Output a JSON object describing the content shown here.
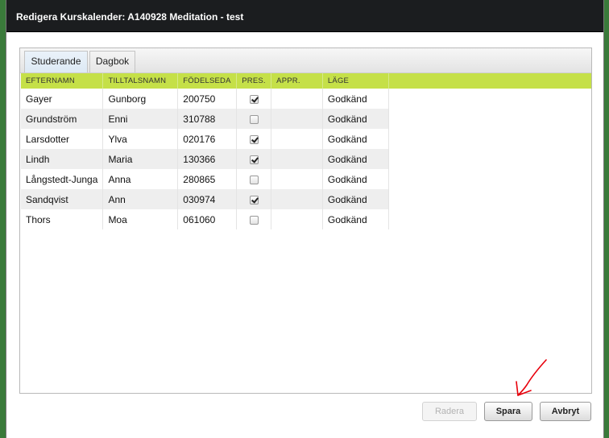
{
  "dialog": {
    "title": "Redigera Kurskalender: A140928 Meditation - test"
  },
  "tabs": [
    {
      "label": "Studerande",
      "active": true
    },
    {
      "label": "Dagbok",
      "active": false
    }
  ],
  "table": {
    "headers": [
      "EFTERNAMN",
      "TILLTALSNAMN",
      "FÖDELSEDA",
      "PRES.",
      "APPR.",
      "LÄGE"
    ],
    "rows": [
      {
        "efternamn": "Gayer",
        "tilltalsnamn": "Gunborg",
        "fodelse": "200750",
        "pres": true,
        "appr": "",
        "lage": "Godkänd"
      },
      {
        "efternamn": "Grundström",
        "tilltalsnamn": "Enni",
        "fodelse": "310788",
        "pres": false,
        "appr": "",
        "lage": "Godkänd"
      },
      {
        "efternamn": "Larsdotter",
        "tilltalsnamn": "Ylva",
        "fodelse": "020176",
        "pres": true,
        "appr": "",
        "lage": "Godkänd"
      },
      {
        "efternamn": "Lindh",
        "tilltalsnamn": "Maria",
        "fodelse": "130366",
        "pres": true,
        "appr": "",
        "lage": "Godkänd"
      },
      {
        "efternamn": "Långstedt-Junga",
        "tilltalsnamn": "Anna",
        "fodelse": "280865",
        "pres": false,
        "appr": "",
        "lage": "Godkänd"
      },
      {
        "efternamn": "Sandqvist",
        "tilltalsnamn": "Ann",
        "fodelse": "030974",
        "pres": true,
        "appr": "",
        "lage": "Godkänd"
      },
      {
        "efternamn": "Thors",
        "tilltalsnamn": "Moa",
        "fodelse": "061060",
        "pres": false,
        "appr": "",
        "lage": "Godkänd"
      }
    ]
  },
  "buttons": {
    "radera": {
      "label": "Radera",
      "disabled": true
    },
    "spara": {
      "label": "Spara"
    },
    "avbryt": {
      "label": "Avbryt"
    }
  },
  "colors": {
    "header_bg": "#c5e048",
    "title_bg": "#1b1d1f",
    "annotation": "#e8000b"
  },
  "annotation": {
    "icon": "hand-drawn-arrow-icon"
  }
}
